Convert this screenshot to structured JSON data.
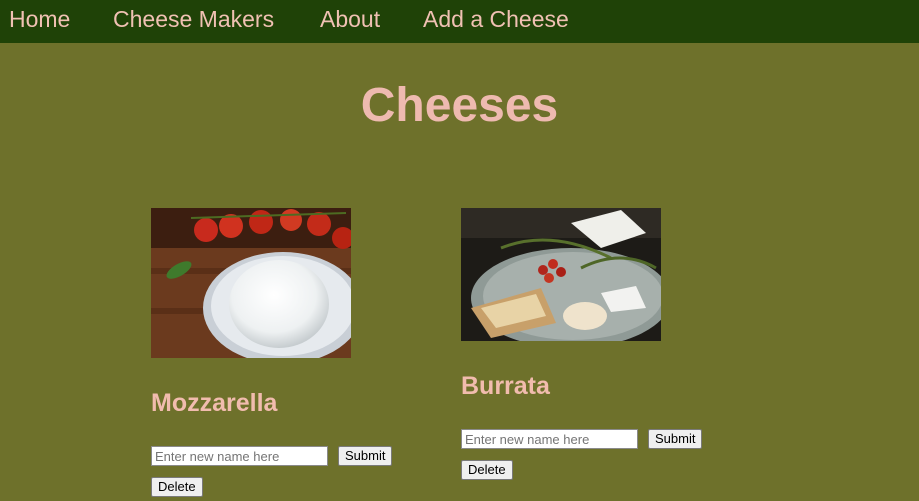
{
  "nav": {
    "home": "Home",
    "cheese_makers": "Cheese Makers",
    "about": "About",
    "add_cheese": "Add a Cheese"
  },
  "page": {
    "title": "Cheeses"
  },
  "cheeses": [
    {
      "name": "Mozzarella",
      "input_placeholder": "Enter new name here",
      "submit_label": "Submit",
      "delete_label": "Delete"
    },
    {
      "name": "Burrata",
      "input_placeholder": "Enter new name here",
      "submit_label": "Submit",
      "delete_label": "Delete"
    }
  ],
  "colors": {
    "background": "#6e712b",
    "nav_background": "#1f4207",
    "accent_text": "#f0c1b3"
  }
}
